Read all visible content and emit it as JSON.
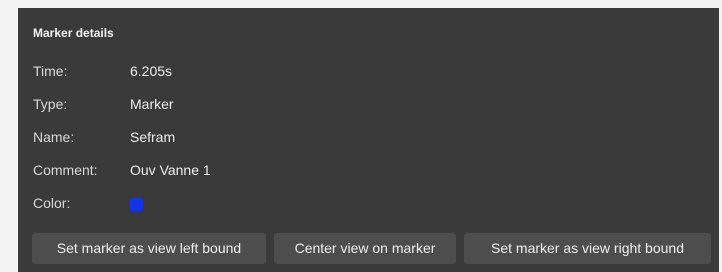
{
  "panel": {
    "title": "Marker details"
  },
  "details": {
    "time_label": "Time:",
    "time_value": "6.205s",
    "type_label": "Type:",
    "type_value": "Marker",
    "name_label": "Name:",
    "name_value": "Sefram",
    "comment_label": "Comment:",
    "comment_value": "Ouv Vanne 1",
    "color_label": "Color:",
    "color_value": "#1233e6"
  },
  "buttons": {
    "left_bound": "Set marker as view left bound",
    "center": "Center view on marker",
    "right_bound": "Set marker as view right bound"
  }
}
